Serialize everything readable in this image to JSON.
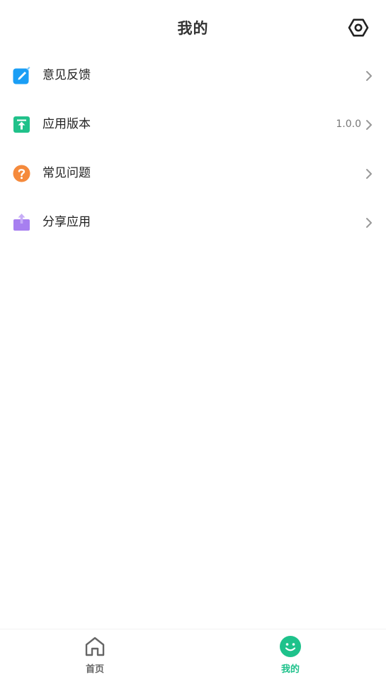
{
  "header": {
    "title": "我的",
    "settings_icon": "settings-hexagon-icon"
  },
  "menu": {
    "items": [
      {
        "label": "意见反馈",
        "icon": "feedback-edit-icon",
        "color": "#1a9ef5",
        "value": ""
      },
      {
        "label": "应用版本",
        "icon": "app-version-upload-icon",
        "color": "#20c18a",
        "value": "1.0.0"
      },
      {
        "label": "常见问题",
        "icon": "faq-question-icon",
        "color": "#f58a3c",
        "value": ""
      },
      {
        "label": "分享应用",
        "icon": "share-app-icon",
        "color": "#a77ff0",
        "value": ""
      }
    ]
  },
  "tabbar": {
    "tabs": [
      {
        "label": "首页",
        "icon": "home-icon",
        "active": false
      },
      {
        "label": "我的",
        "icon": "smiley-face-icon",
        "active": true
      }
    ],
    "active_color": "#1ec28b",
    "inactive_color": "#666666"
  }
}
